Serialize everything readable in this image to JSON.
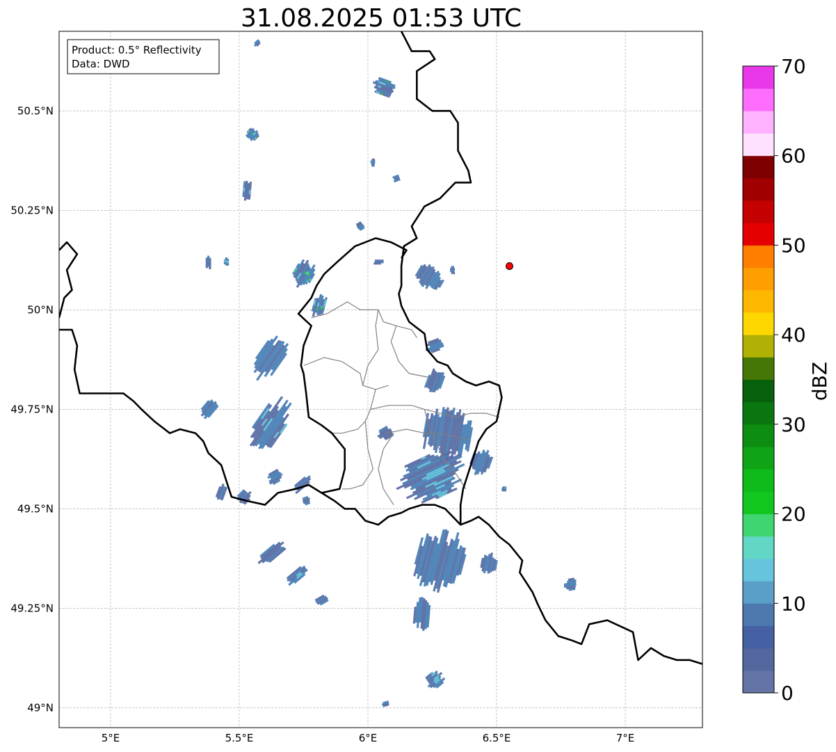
{
  "title": "31.08.2025 01:53 UTC",
  "info_box": {
    "product": "Product: 0.5° Reflectivity",
    "data": "Data: DWD"
  },
  "map": {
    "lon_range": [
      4.8,
      7.3
    ],
    "lat_range": [
      48.95,
      50.7
    ],
    "lon_ticks": [
      {
        "value": 5.0,
        "label": "5°E"
      },
      {
        "value": 5.5,
        "label": "5.5°E"
      },
      {
        "value": 6.0,
        "label": "6°E"
      },
      {
        "value": 6.5,
        "label": "6.5°E"
      },
      {
        "value": 7.0,
        "label": "7°E"
      }
    ],
    "lat_ticks": [
      {
        "value": 49.0,
        "label": "49°N"
      },
      {
        "value": 49.25,
        "label": "49.25°N"
      },
      {
        "value": 49.5,
        "label": "49.5°N"
      },
      {
        "value": 49.75,
        "label": "49.75°N"
      },
      {
        "value": 50.0,
        "label": "50°N"
      },
      {
        "value": 50.25,
        "label": "50.25°N"
      },
      {
        "value": 50.5,
        "label": "50.5°N"
      }
    ],
    "gridlines": true,
    "radar_site": {
      "lon": 6.55,
      "lat": 50.11,
      "color": "#ff0000"
    },
    "border_color": "#000000",
    "subdivision_color": "#808080",
    "echo_colors": {
      "weak": "#5a6ea4",
      "light": "#4a7fb5",
      "moderate": "#66c6dc",
      "green": "#2fcc2f"
    },
    "echoes": [
      {
        "lon": 5.55,
        "lat": 50.44,
        "len": 0.05,
        "wid": 0.03,
        "ang": -45,
        "mix": "green"
      },
      {
        "lon": 5.53,
        "lat": 50.3,
        "len": 0.09,
        "wid": 0.02,
        "ang": -85,
        "mix": "moderate"
      },
      {
        "lon": 6.06,
        "lat": 50.56,
        "len": 0.1,
        "wid": 0.04,
        "ang": 20,
        "mix": "green"
      },
      {
        "lon": 6.02,
        "lat": 50.37,
        "len": 0.02,
        "wid": 0.02,
        "ang": 0,
        "mix": "weak"
      },
      {
        "lon": 6.11,
        "lat": 50.33,
        "len": 0.03,
        "wid": 0.015,
        "ang": -20,
        "mix": "weak"
      },
      {
        "lon": 5.38,
        "lat": 50.12,
        "len": 0.06,
        "wid": 0.012,
        "ang": -90,
        "mix": "moderate"
      },
      {
        "lon": 5.45,
        "lat": 50.12,
        "len": 0.03,
        "wid": 0.008,
        "ang": -90,
        "mix": "moderate"
      },
      {
        "lon": 5.75,
        "lat": 50.09,
        "len": 0.1,
        "wid": 0.05,
        "ang": -60,
        "mix": "green"
      },
      {
        "lon": 5.81,
        "lat": 50.01,
        "len": 0.1,
        "wid": 0.03,
        "ang": -75,
        "mix": "green"
      },
      {
        "lon": 5.97,
        "lat": 50.21,
        "len": 0.03,
        "wid": 0.02,
        "ang": -30,
        "mix": "weak"
      },
      {
        "lon": 6.04,
        "lat": 50.12,
        "len": 0.04,
        "wid": 0.01,
        "ang": 0,
        "mix": "weak"
      },
      {
        "lon": 6.24,
        "lat": 50.08,
        "len": 0.09,
        "wid": 0.07,
        "ang": -60,
        "mix": "light"
      },
      {
        "lon": 6.33,
        "lat": 50.1,
        "len": 0.02,
        "wid": 0.02,
        "ang": 0,
        "mix": "weak"
      },
      {
        "lon": 5.62,
        "lat": 49.88,
        "len": 0.19,
        "wid": 0.06,
        "ang": -55,
        "mix": "light"
      },
      {
        "lon": 5.62,
        "lat": 49.71,
        "len": 0.22,
        "wid": 0.07,
        "ang": -55,
        "mix": "moderate"
      },
      {
        "lon": 5.74,
        "lat": 49.56,
        "len": 0.1,
        "wid": 0.02,
        "ang": -40,
        "mix": "weak"
      },
      {
        "lon": 5.38,
        "lat": 49.75,
        "len": 0.09,
        "wid": 0.03,
        "ang": -50,
        "mix": "light"
      },
      {
        "lon": 5.64,
        "lat": 49.58,
        "len": 0.06,
        "wid": 0.03,
        "ang": -30,
        "mix": "weak"
      },
      {
        "lon": 5.76,
        "lat": 49.52,
        "len": 0.03,
        "wid": 0.02,
        "ang": -20,
        "mix": "weak"
      },
      {
        "lon": 5.43,
        "lat": 49.54,
        "len": 0.07,
        "wid": 0.02,
        "ang": -70,
        "mix": "weak"
      },
      {
        "lon": 5.52,
        "lat": 49.53,
        "len": 0.06,
        "wid": 0.03,
        "ang": -45,
        "mix": "weak"
      },
      {
        "lon": 5.63,
        "lat": 49.39,
        "len": 0.13,
        "wid": 0.03,
        "ang": -40,
        "mix": "weak"
      },
      {
        "lon": 5.72,
        "lat": 49.33,
        "len": 0.1,
        "wid": 0.025,
        "ang": -40,
        "mix": "moderate"
      },
      {
        "lon": 5.82,
        "lat": 49.27,
        "len": 0.05,
        "wid": 0.02,
        "ang": -30,
        "mix": "weak"
      },
      {
        "lon": 6.26,
        "lat": 49.91,
        "len": 0.07,
        "wid": 0.03,
        "ang": -20,
        "mix": "light"
      },
      {
        "lon": 6.26,
        "lat": 49.82,
        "len": 0.1,
        "wid": 0.04,
        "ang": -70,
        "mix": "light"
      },
      {
        "lon": 6.07,
        "lat": 49.69,
        "len": 0.06,
        "wid": 0.03,
        "ang": -30,
        "mix": "weak"
      },
      {
        "lon": 6.31,
        "lat": 49.69,
        "len": 0.2,
        "wid": 0.12,
        "ang": -80,
        "mix": "light"
      },
      {
        "lon": 6.25,
        "lat": 49.58,
        "len": 0.26,
        "wid": 0.11,
        "ang": -25,
        "mix": "moderate"
      },
      {
        "lon": 6.44,
        "lat": 49.62,
        "len": 0.1,
        "wid": 0.05,
        "ang": -70,
        "mix": "light"
      },
      {
        "lon": 6.28,
        "lat": 49.37,
        "len": 0.24,
        "wid": 0.12,
        "ang": -75,
        "mix": "light"
      },
      {
        "lon": 6.21,
        "lat": 49.24,
        "len": 0.14,
        "wid": 0.04,
        "ang": -85,
        "mix": "weak"
      },
      {
        "lon": 6.47,
        "lat": 49.36,
        "len": 0.08,
        "wid": 0.04,
        "ang": -80,
        "mix": "weak"
      },
      {
        "lon": 6.26,
        "lat": 49.07,
        "len": 0.07,
        "wid": 0.04,
        "ang": -40,
        "mix": "moderate"
      },
      {
        "lon": 6.07,
        "lat": 49.01,
        "len": 0.03,
        "wid": 0.01,
        "ang": -15,
        "mix": "weak"
      },
      {
        "lon": 6.79,
        "lat": 49.31,
        "len": 0.05,
        "wid": 0.03,
        "ang": -10,
        "mix": "weak"
      },
      {
        "lon": 6.53,
        "lat": 49.55,
        "len": 0.02,
        "wid": 0.01,
        "ang": 0,
        "mix": "green"
      },
      {
        "lon": 5.57,
        "lat": 50.67,
        "len": 0.03,
        "wid": 0.01,
        "ang": -45,
        "mix": "moderate"
      }
    ],
    "borders": [
      [
        [
          6.13,
          50.7
        ],
        [
          6.17,
          50.65
        ],
        [
          6.24,
          50.65
        ],
        [
          6.26,
          50.63
        ],
        [
          6.19,
          50.6
        ],
        [
          6.19,
          50.53
        ],
        [
          6.25,
          50.5
        ],
        [
          6.32,
          50.5
        ],
        [
          6.35,
          50.47
        ],
        [
          6.35,
          50.4
        ],
        [
          6.39,
          50.35
        ],
        [
          6.4,
          50.32
        ],
        [
          6.34,
          50.32
        ],
        [
          6.28,
          50.28
        ],
        [
          6.22,
          50.26
        ],
        [
          6.19,
          50.23
        ],
        [
          6.17,
          50.21
        ],
        [
          6.19,
          50.18
        ],
        [
          6.14,
          50.16
        ],
        [
          6.13,
          50.11
        ],
        [
          6.13,
          50.06
        ],
        [
          6.12,
          50.04
        ],
        [
          6.13,
          50.01
        ],
        [
          6.16,
          49.97
        ],
        [
          6.22,
          49.94
        ],
        [
          6.23,
          49.9
        ],
        [
          6.27,
          49.87
        ],
        [
          6.31,
          49.86
        ],
        [
          6.33,
          49.84
        ],
        [
          6.38,
          49.82
        ],
        [
          6.42,
          49.81
        ],
        [
          6.47,
          49.82
        ],
        [
          6.51,
          49.81
        ],
        [
          6.52,
          49.78
        ],
        [
          6.51,
          49.75
        ],
        [
          6.5,
          49.72
        ],
        [
          6.46,
          49.7
        ],
        [
          6.43,
          49.67
        ],
        [
          6.41,
          49.63
        ],
        [
          6.39,
          49.59
        ],
        [
          6.37,
          49.55
        ],
        [
          6.36,
          49.51
        ],
        [
          6.36,
          49.46
        ]
      ],
      [
        [
          4.8,
          50.15
        ],
        [
          4.83,
          50.17
        ],
        [
          4.87,
          50.14
        ],
        [
          4.83,
          50.1
        ],
        [
          4.85,
          50.05
        ],
        [
          4.82,
          50.03
        ],
        [
          4.8,
          49.98
        ]
      ],
      [
        [
          4.8,
          49.95
        ],
        [
          4.85,
          49.95
        ],
        [
          4.87,
          49.91
        ],
        [
          4.86,
          49.85
        ],
        [
          4.88,
          49.79
        ],
        [
          4.95,
          49.79
        ],
        [
          5.0,
          49.79
        ],
        [
          5.05,
          49.79
        ],
        [
          5.09,
          49.77
        ],
        [
          5.12,
          49.75
        ],
        [
          5.17,
          49.72
        ],
        [
          5.23,
          49.69
        ],
        [
          5.27,
          49.7
        ],
        [
          5.33,
          49.69
        ],
        [
          5.36,
          49.67
        ],
        [
          5.38,
          49.64
        ],
        [
          5.43,
          49.61
        ],
        [
          5.45,
          49.57
        ],
        [
          5.47,
          49.53
        ],
        [
          5.53,
          49.52
        ],
        [
          5.6,
          49.51
        ],
        [
          5.65,
          49.54
        ],
        [
          5.72,
          49.55
        ],
        [
          5.77,
          49.56
        ],
        [
          5.82,
          49.54
        ]
      ],
      [
        [
          5.82,
          49.54
        ],
        [
          5.87,
          49.52
        ],
        [
          5.91,
          49.5
        ],
        [
          5.95,
          49.5
        ],
        [
          5.99,
          49.47
        ],
        [
          6.04,
          49.46
        ],
        [
          6.08,
          49.48
        ],
        [
          6.13,
          49.49
        ],
        [
          6.16,
          49.5
        ],
        [
          6.21,
          49.51
        ],
        [
          6.26,
          49.51
        ],
        [
          6.3,
          49.5
        ],
        [
          6.36,
          49.46
        ],
        [
          6.4,
          49.47
        ],
        [
          6.43,
          49.48
        ],
        [
          6.47,
          49.46
        ],
        [
          6.51,
          49.43
        ],
        [
          6.55,
          49.41
        ],
        [
          6.6,
          49.37
        ],
        [
          6.59,
          49.34
        ],
        [
          6.64,
          49.29
        ],
        [
          6.66,
          49.26
        ],
        [
          6.69,
          49.22
        ],
        [
          6.74,
          49.18
        ],
        [
          6.79,
          49.17
        ],
        [
          6.83,
          49.16
        ],
        [
          6.86,
          49.21
        ],
        [
          6.93,
          49.22
        ],
        [
          7.03,
          49.19
        ],
        [
          7.05,
          49.12
        ],
        [
          7.1,
          49.15
        ],
        [
          7.15,
          49.13
        ],
        [
          7.2,
          49.12
        ],
        [
          7.25,
          49.12
        ],
        [
          7.3,
          49.11
        ]
      ],
      [
        [
          5.82,
          49.54
        ],
        [
          5.89,
          49.55
        ],
        [
          5.91,
          49.6
        ],
        [
          5.91,
          49.65
        ],
        [
          5.86,
          49.69
        ],
        [
          5.82,
          49.71
        ],
        [
          5.77,
          49.73
        ],
        [
          5.76,
          49.79
        ],
        [
          5.75,
          49.84
        ],
        [
          5.74,
          49.86
        ],
        [
          5.75,
          49.91
        ],
        [
          5.78,
          49.96
        ],
        [
          5.73,
          49.99
        ],
        [
          5.78,
          50.03
        ],
        [
          5.8,
          50.06
        ],
        [
          5.83,
          50.09
        ],
        [
          5.88,
          50.12
        ],
        [
          5.95,
          50.16
        ],
        [
          6.03,
          50.18
        ],
        [
          6.09,
          50.17
        ],
        [
          6.12,
          50.16
        ],
        [
          6.15,
          50.15
        ],
        [
          6.13,
          50.13
        ]
      ]
    ],
    "subdivisions": [
      [
        [
          5.78,
          49.98
        ],
        [
          5.84,
          49.99
        ],
        [
          5.92,
          50.02
        ],
        [
          5.97,
          50.0
        ],
        [
          6.04,
          50.0
        ],
        [
          6.06,
          49.97
        ],
        [
          6.11,
          49.96
        ],
        [
          6.17,
          49.95
        ],
        [
          6.19,
          49.93
        ]
      ],
      [
        [
          6.04,
          50.0
        ],
        [
          6.03,
          49.96
        ],
        [
          6.04,
          49.9
        ],
        [
          6.0,
          49.86
        ],
        [
          5.98,
          49.81
        ],
        [
          6.03,
          49.8
        ],
        [
          6.08,
          49.81
        ]
      ],
      [
        [
          6.11,
          49.96
        ],
        [
          6.09,
          49.92
        ],
        [
          6.12,
          49.87
        ],
        [
          6.16,
          49.84
        ],
        [
          6.24,
          49.83
        ]
      ],
      [
        [
          5.75,
          49.86
        ],
        [
          5.83,
          49.88
        ],
        [
          5.9,
          49.87
        ],
        [
          5.97,
          49.84
        ],
        [
          5.98,
          49.81
        ]
      ],
      [
        [
          6.03,
          49.8
        ],
        [
          6.01,
          49.75
        ],
        [
          5.99,
          49.72
        ],
        [
          5.96,
          49.7
        ],
        [
          5.9,
          49.69
        ],
        [
          5.86,
          49.69
        ]
      ],
      [
        [
          6.01,
          49.75
        ],
        [
          6.08,
          49.76
        ],
        [
          6.17,
          49.76
        ],
        [
          6.22,
          49.75
        ],
        [
          6.28,
          49.74
        ],
        [
          6.34,
          49.73
        ],
        [
          6.4,
          49.74
        ],
        [
          6.46,
          49.74
        ],
        [
          6.51,
          49.73
        ]
      ],
      [
        [
          5.99,
          49.72
        ],
        [
          6.0,
          49.65
        ],
        [
          6.02,
          49.6
        ],
        [
          5.98,
          49.56
        ],
        [
          5.93,
          49.55
        ],
        [
          5.9,
          49.55
        ]
      ],
      [
        [
          6.1,
          49.69
        ],
        [
          6.06,
          49.65
        ],
        [
          6.04,
          49.6
        ],
        [
          6.06,
          49.55
        ],
        [
          6.1,
          49.51
        ]
      ],
      [
        [
          6.22,
          49.75
        ],
        [
          6.24,
          49.7
        ],
        [
          6.27,
          49.66
        ],
        [
          6.3,
          49.62
        ],
        [
          6.34,
          49.59
        ],
        [
          6.38,
          49.55
        ]
      ],
      [
        [
          6.07,
          49.69
        ],
        [
          6.15,
          49.7
        ],
        [
          6.22,
          49.69
        ],
        [
          6.28,
          49.69
        ],
        [
          6.35,
          49.68
        ],
        [
          6.4,
          49.67
        ]
      ]
    ]
  },
  "colorbar": {
    "label": "dBZ",
    "min": 0,
    "max": 70,
    "step": 2.5,
    "ticks": [
      "0",
      "10",
      "20",
      "30",
      "40",
      "50",
      "60",
      "70"
    ],
    "colors": [
      "#6474a6",
      "#54679f",
      "#4560a3",
      "#4d78b0",
      "#5a9fc8",
      "#66c4dc",
      "#62d7c5",
      "#3fd672",
      "#11c71f",
      "#0fbb1a",
      "#0fa415",
      "#0d8d12",
      "#0a760f",
      "#07600c",
      "#447706",
      "#b0b104",
      "#ffd700",
      "#ffb801",
      "#ff9e00",
      "#ff7e00",
      "#e40000",
      "#c50000",
      "#a10000",
      "#7e0000",
      "#ffe0ff",
      "#ffb2ff",
      "#ff6dff",
      "#e938e9"
    ]
  }
}
